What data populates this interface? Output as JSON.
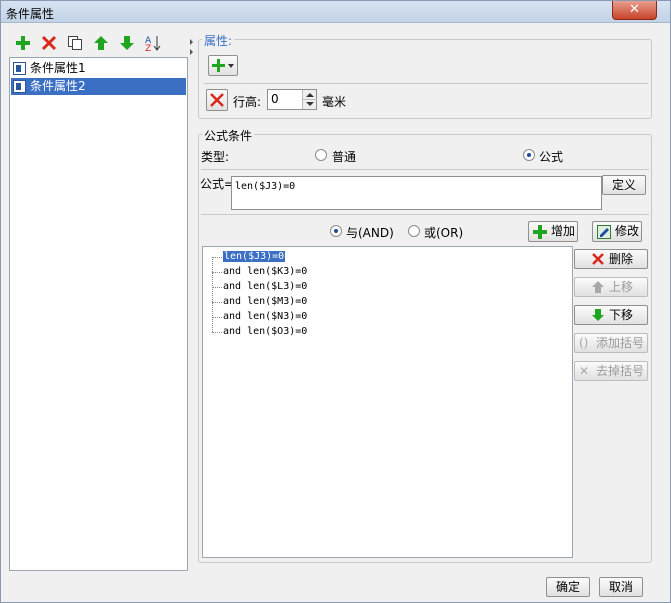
{
  "window": {
    "title": "条件属性",
    "close_glyph": "✕"
  },
  "conditions": {
    "items": [
      {
        "label": "条件属性1"
      },
      {
        "label": "条件属性2"
      }
    ]
  },
  "property": {
    "group_title": "属性:",
    "row_height_label": "行高:",
    "row_height_value": "0",
    "unit": "毫米"
  },
  "formula": {
    "group_title": "公式条件",
    "type_label": "类型:",
    "type_options": [
      "普通",
      "公式"
    ],
    "type_selected": "公式",
    "formula_label": "公式=",
    "formula_value": "len($J3)=0",
    "define_button": "定义",
    "logic_and": "与(AND)",
    "logic_or": "或(OR)",
    "logic_selected": "与(AND)",
    "add_button": "增加",
    "modify_button": "修改"
  },
  "tree": {
    "rows": [
      "len($J3)=0",
      "and len($K3)=0",
      "and len($L3)=0",
      "and len($M3)=0",
      "and len($N3)=0",
      "and len($O3)=0"
    ]
  },
  "side_buttons": {
    "delete": "删除",
    "up": "上移",
    "down": "下移",
    "add_bracket": "添加括号",
    "remove_bracket": "去掉括号"
  },
  "footer": {
    "ok": "确定",
    "cancel": "取消"
  },
  "colors": {
    "accent": "#3a6fc4",
    "add_green": "#1fa51f",
    "delete_red": "#d9281e"
  }
}
